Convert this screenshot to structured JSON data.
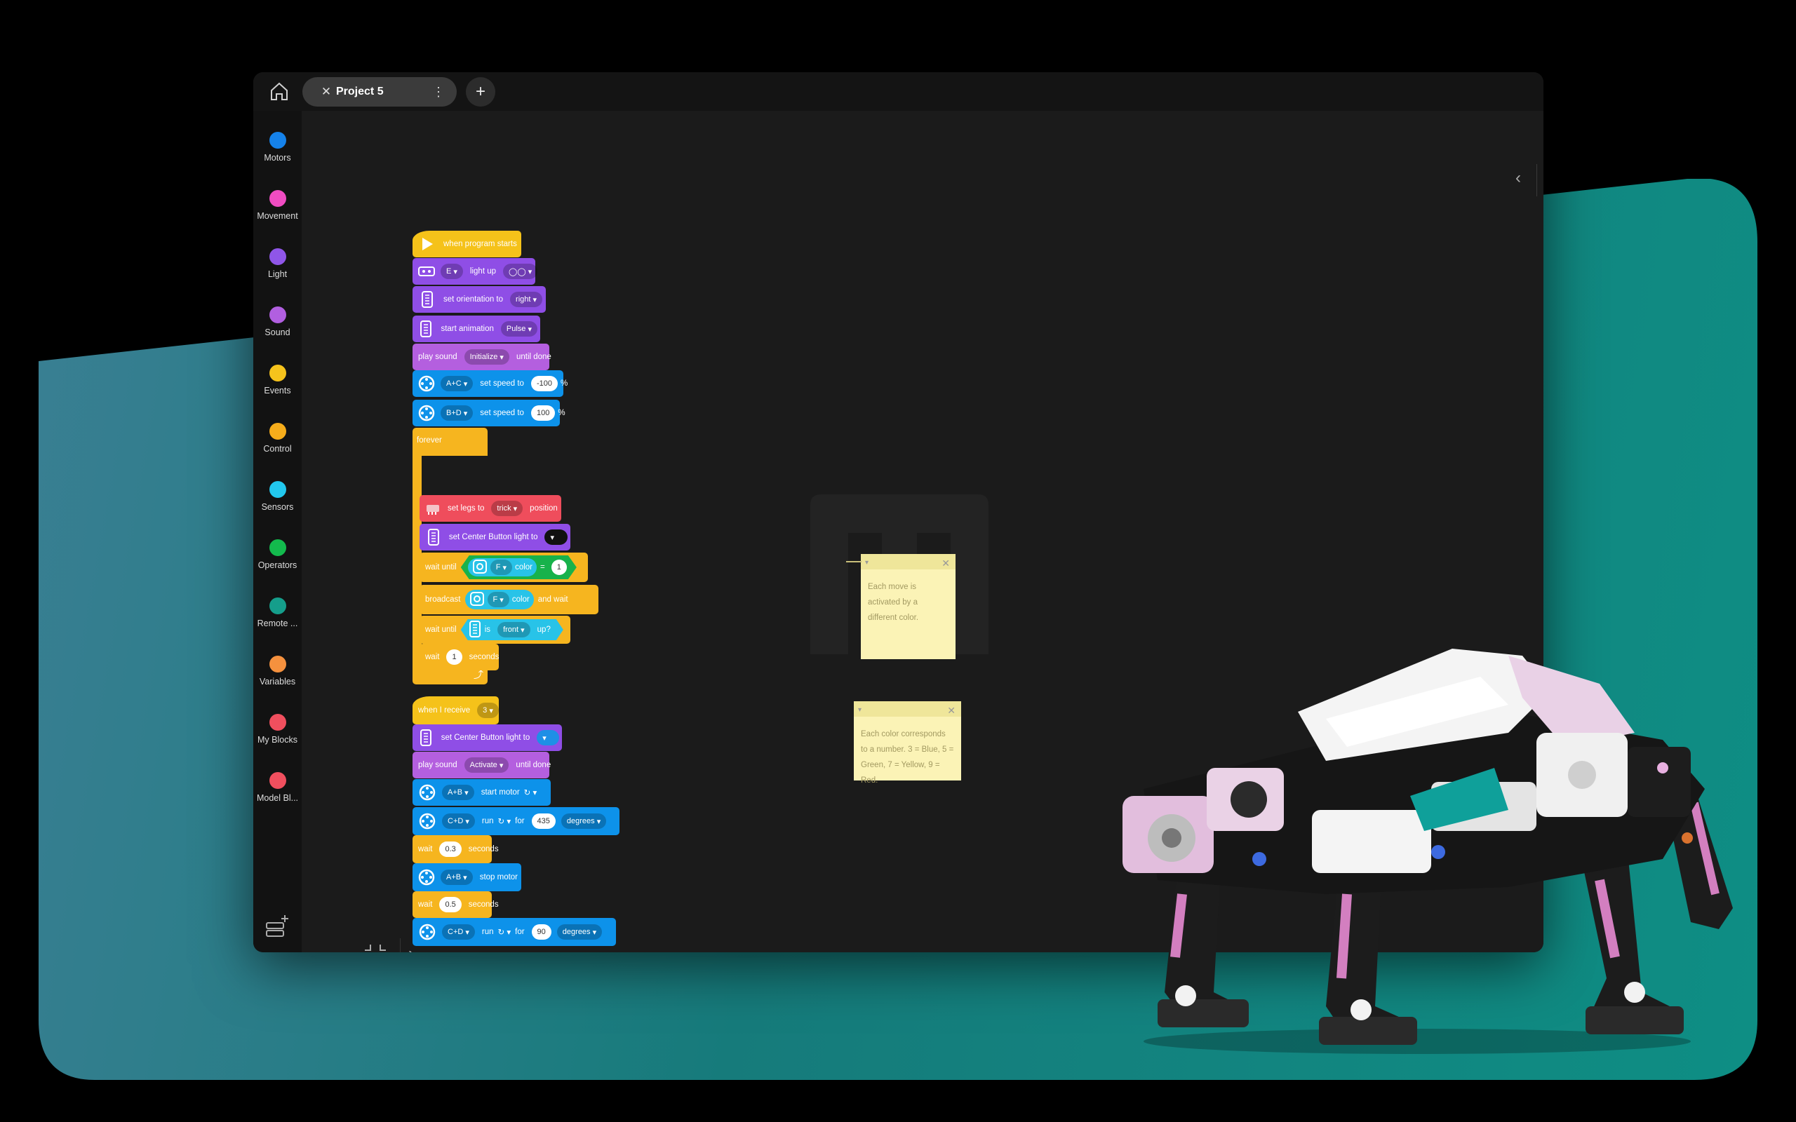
{
  "tab": {
    "title": "Project 5"
  },
  "sidebar": {
    "categories": [
      {
        "label": "Motors",
        "color": "#1582ea"
      },
      {
        "label": "Movement",
        "color": "#f04cc2"
      },
      {
        "label": "Light",
        "color": "#8f56e8"
      },
      {
        "label": "Sound",
        "color": "#b15fe0"
      },
      {
        "label": "Events",
        "color": "#f6c31c"
      },
      {
        "label": "Control",
        "color": "#f6ad1b"
      },
      {
        "label": "Sensors",
        "color": "#22c8ee"
      },
      {
        "label": "Operators",
        "color": "#13ba4d"
      },
      {
        "label": "Remote ...",
        "color": "#159e8b"
      },
      {
        "label": "Variables",
        "color": "#f5913e"
      },
      {
        "label": "My Blocks",
        "color": "#f04f5e"
      },
      {
        "label": "Model Bl...",
        "color": "#f04f5e"
      }
    ]
  },
  "stack1": {
    "hat": "when program starts",
    "b1": {
      "port": "E",
      "text": "light up"
    },
    "b2": {
      "text": "set orientation to",
      "value": "right"
    },
    "b3": {
      "text": "start animation",
      "value": "Pulse"
    },
    "b4": {
      "pre": "play sound",
      "value": "Initialize",
      "post": "until done"
    },
    "b5": {
      "port": "A+C",
      "text": "set speed to",
      "value": "-100",
      "unit": "%"
    },
    "b6": {
      "port": "B+D",
      "text": "set speed to",
      "value": "100",
      "unit": "%"
    },
    "forever": "forever",
    "f1": {
      "pre": "set legs to",
      "value": "trick",
      "post": "position"
    },
    "f2": {
      "text": "set Center Button light to"
    },
    "f3": {
      "pre": "wait until",
      "port": "F",
      "sensor": "color",
      "op": "=",
      "value": "1"
    },
    "f4": {
      "pre": "broadcast",
      "port": "F",
      "sensor": "color",
      "post": "and wait"
    },
    "f5": {
      "pre": "wait until",
      "mid": "is",
      "value": "front",
      "post": "up?"
    },
    "f6": {
      "pre": "wait",
      "value": "1",
      "post": "seconds"
    }
  },
  "note1": {
    "text": "Each move is activated by a different color."
  },
  "stack2": {
    "hat": {
      "text": "when I receive",
      "value": "3"
    },
    "b1": {
      "text": "set Center Button light to"
    },
    "b2": {
      "pre": "play sound",
      "value": "Activate",
      "post": "until done"
    },
    "b3": {
      "port": "A+B",
      "text": "start motor"
    },
    "b4": {
      "port": "C+D",
      "pre": "run",
      "mid": "for",
      "value": "435",
      "unit": "degrees"
    },
    "b5": {
      "pre": "wait",
      "value": "0.3",
      "post": "seconds"
    },
    "b6": {
      "port": "A+B",
      "text": "stop motor"
    },
    "b7": {
      "pre": "wait",
      "value": "0.5",
      "post": "seconds"
    },
    "b8": {
      "port": "C+D",
      "pre": "run",
      "mid": "for",
      "value": "90",
      "unit": "degrees"
    }
  },
  "note2": {
    "text": "Each color corresponds to a number. 3 = Blue, 5 = Green, 7 = Yellow, 9 = Red."
  }
}
